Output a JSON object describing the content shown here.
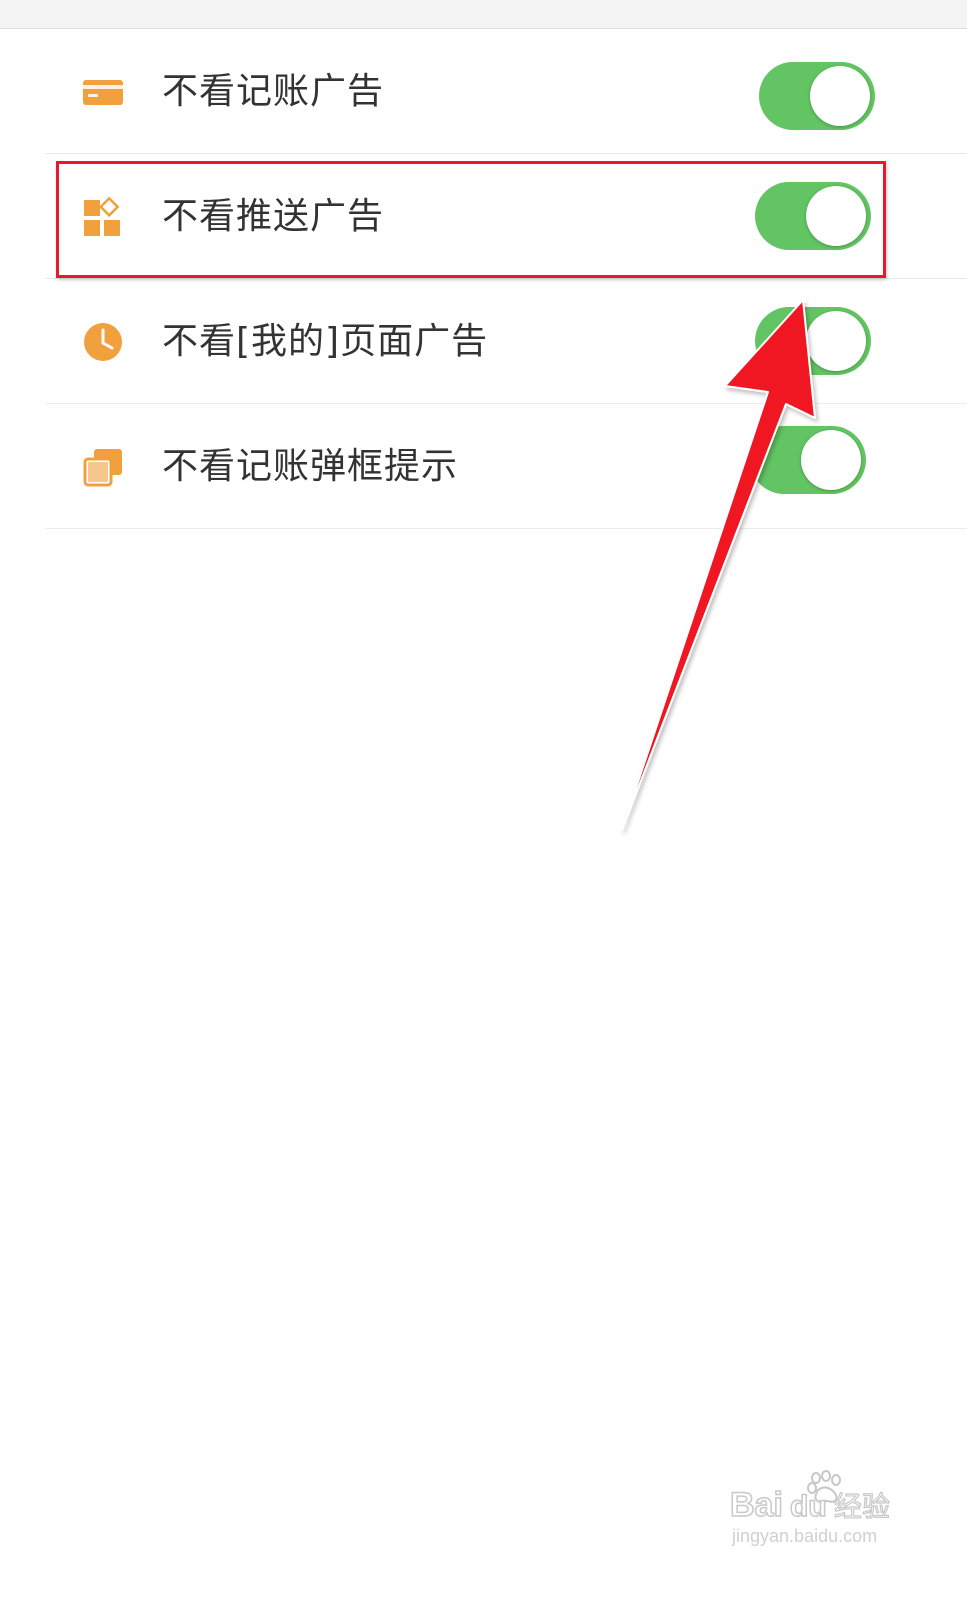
{
  "settings": {
    "items": [
      {
        "label": "不看记账广告",
        "icon": "card-icon",
        "enabled": true
      },
      {
        "label": "不看推送广告",
        "icon": "apps-grid-icon",
        "enabled": true
      },
      {
        "label": "不看[我的]页面广告",
        "icon": "clock-icon",
        "enabled": true
      },
      {
        "label": "不看记账弹框提示",
        "icon": "stacked-windows-icon",
        "enabled": true
      }
    ]
  },
  "colors": {
    "icon": "#f0a03c",
    "toggle_on": "#62c462",
    "highlight": "#e8192c",
    "arrow": "#f01420"
  },
  "watermark": {
    "brand": "Baidu经验",
    "url": "jingyan.baidu.com"
  }
}
